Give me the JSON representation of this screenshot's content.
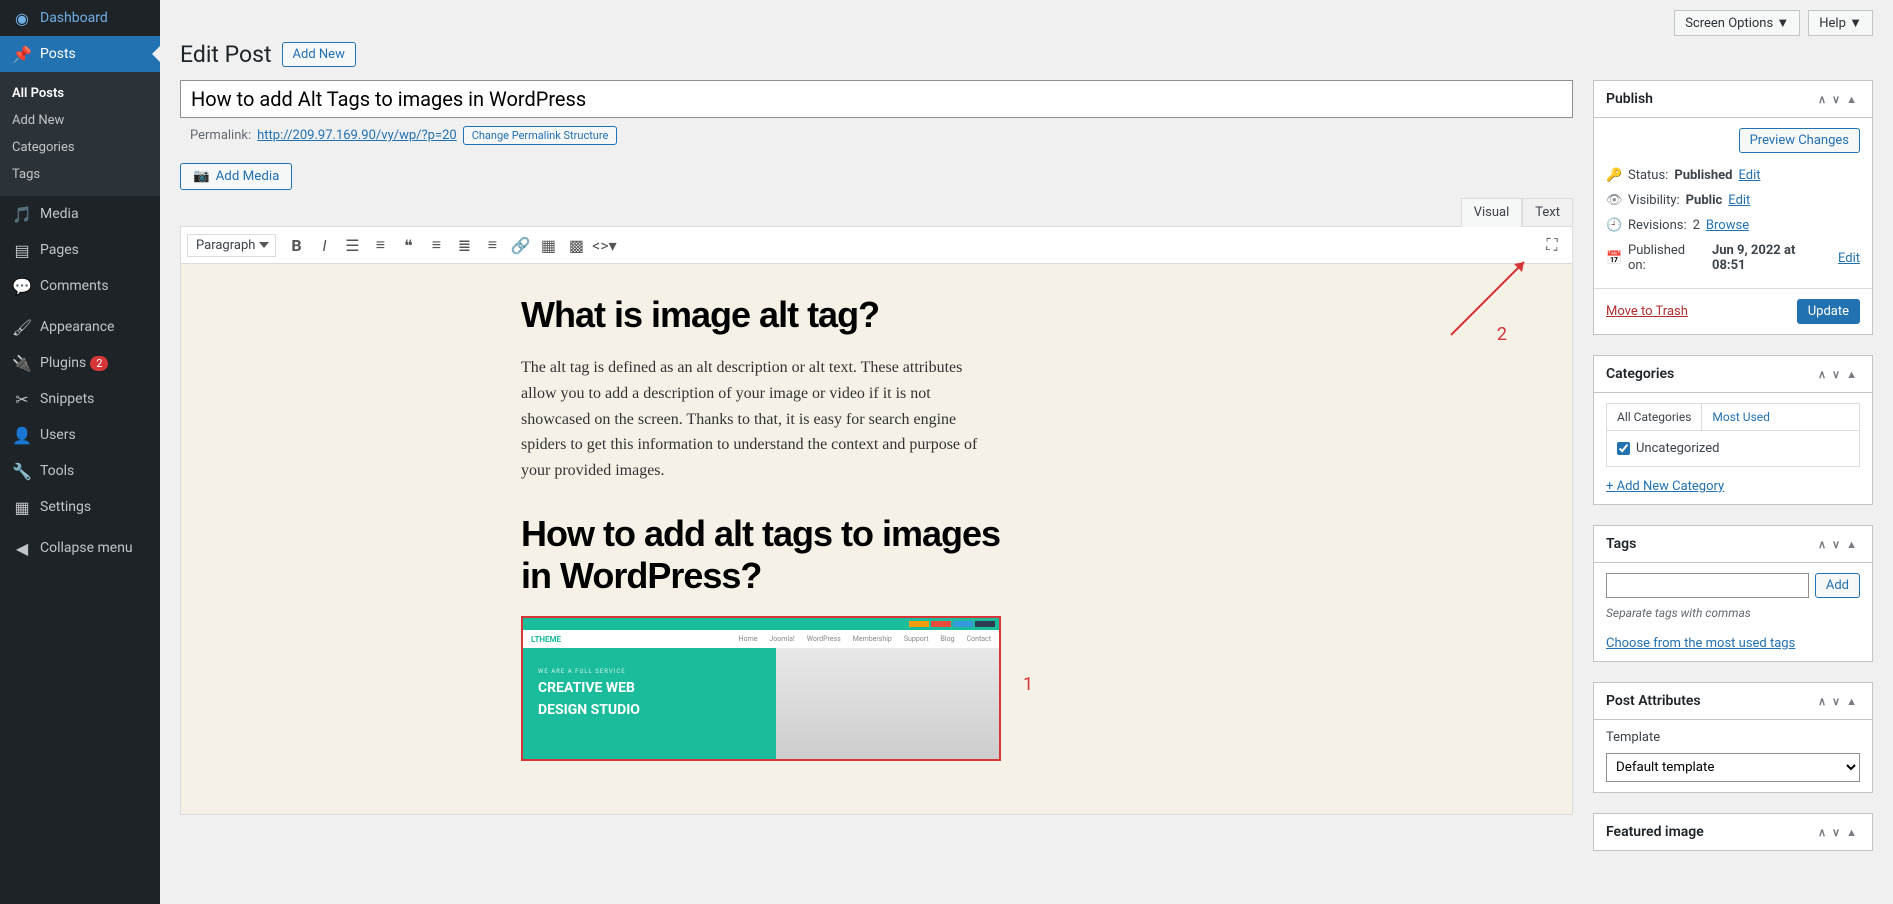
{
  "sidebar": {
    "items": [
      {
        "icon": "◐",
        "label": "Dashboard"
      },
      {
        "icon": "📌",
        "label": "Posts",
        "active": true
      },
      {
        "icon": "🖾",
        "label": "Media"
      },
      {
        "icon": "▤",
        "label": "Pages"
      },
      {
        "icon": "💬",
        "label": "Comments"
      },
      {
        "icon": "🖌",
        "label": "Appearance"
      },
      {
        "icon": "🔌",
        "label": "Plugins",
        "badge": "2"
      },
      {
        "icon": "✂",
        "label": "Snippets"
      },
      {
        "icon": "👤",
        "label": "Users"
      },
      {
        "icon": "🔧",
        "label": "Tools"
      },
      {
        "icon": "▦",
        "label": "Settings"
      },
      {
        "icon": "◀",
        "label": "Collapse menu"
      }
    ],
    "sub": [
      "All Posts",
      "Add New",
      "Categories",
      "Tags"
    ]
  },
  "topbar": {
    "screen_options": "Screen Options",
    "help": "Help"
  },
  "header": {
    "title": "Edit Post",
    "add_new": "Add New"
  },
  "post": {
    "title": "How to add Alt Tags to images in WordPress",
    "permalink_label": "Permalink:",
    "permalink_url": "http://209.97.169.90/vy/wp/?p=20",
    "permalink_btn": "Change Permalink Structure",
    "add_media": "Add Media",
    "format_sel": "Paragraph",
    "tabs": {
      "visual": "Visual",
      "text": "Text"
    },
    "h2_1": "What is image alt tag?",
    "para": "The alt tag is defined as an alt description or alt text. These attributes allow you to add a description of your image or video if it is not showcased on the screen. Thanks to that,  it is easy for search engine spiders to get this information to understand the context and purpose of your provided images.",
    "h2_2": "How to add alt tags to images in WordPress?",
    "imgsite": {
      "logo": "LTHEME",
      "nav": [
        "Home",
        "Joomla!",
        "WordPress",
        "Membership",
        "Support",
        "Blog",
        "Contact"
      ],
      "sub": "WE ARE A FULL SERVICE",
      "big1": "CREATIVE WEB",
      "big2": "DESIGN STUDIO"
    },
    "anno1": "1",
    "anno2": "2"
  },
  "publish": {
    "title": "Publish",
    "preview": "Preview Changes",
    "status_l": "Status:",
    "status_v": "Published",
    "edit": "Edit",
    "vis_l": "Visibility:",
    "vis_v": "Public",
    "rev_l": "Revisions:",
    "rev_v": "2",
    "browse": "Browse",
    "pub_l": "Published on:",
    "pub_v": "Jun 9, 2022 at 08:51",
    "trash": "Move to Trash",
    "update": "Update"
  },
  "categories": {
    "title": "Categories",
    "tab_all": "All Categories",
    "tab_most": "Most Used",
    "item": "Uncategorized",
    "add": "+ Add New Category"
  },
  "tags": {
    "title": "Tags",
    "add": "Add",
    "hint": "Separate tags with commas",
    "link": "Choose from the most used tags"
  },
  "attrs": {
    "title": "Post Attributes",
    "tpl_label": "Template",
    "tpl_value": "Default template"
  },
  "featured": {
    "title": "Featured image"
  }
}
